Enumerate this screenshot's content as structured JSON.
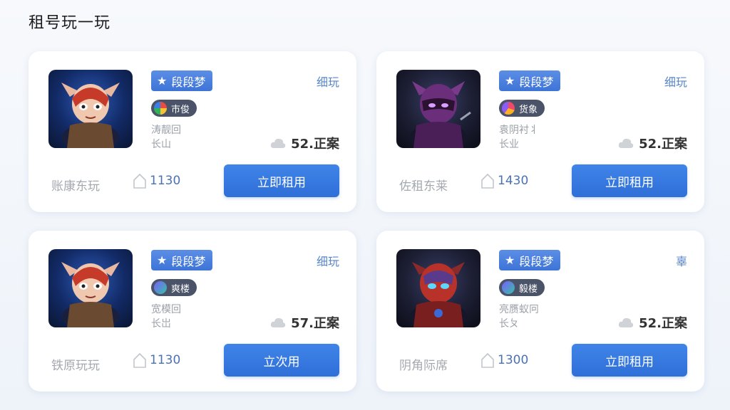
{
  "page": {
    "title": "租号玩一玩"
  },
  "cards": [
    {
      "rank": "段段梦",
      "platform": "巿俊",
      "desc_line1": "涛靓回",
      "desc_line2": "长山",
      "tag": "细玩",
      "price": "52.正案",
      "owner": "账康东玩",
      "count": "1130",
      "button": "立即租用",
      "avatar": "robot-elf-avatar"
    },
    {
      "rank": "段段梦",
      "platform": "货象",
      "desc_line1": "袁阴衬丬",
      "desc_line2": "长业",
      "tag": "细玩",
      "price": "52.正案",
      "owner": "佐租东莱",
      "count": "1430",
      "button": "立即租用",
      "avatar": "purple-ninja-avatar"
    },
    {
      "rank": "段段梦",
      "platform": "爽楼",
      "desc_line1": "宽模回",
      "desc_line2": "长岀",
      "tag": "细玩",
      "price": "57.正案",
      "owner": "铁原玩玩",
      "count": "1130",
      "button": "立次用",
      "avatar": "robot-elf-avatar"
    },
    {
      "rank": "段段梦",
      "platform": "毅楼",
      "desc_line1": "亮赝蚁冋",
      "desc_line2": "长ㄆ",
      "tag": "辜",
      "price": "52.正案",
      "owner": "阴角际席",
      "count": "1300",
      "button": "立即租用",
      "avatar": "red-robot-avatar"
    }
  ],
  "colors": {
    "accent": "#3a7be3",
    "badge": "#4f86e4",
    "platform_badge": "#4a5367",
    "muted_text": "#a4a9b0",
    "count_text": "#4a72b4"
  }
}
